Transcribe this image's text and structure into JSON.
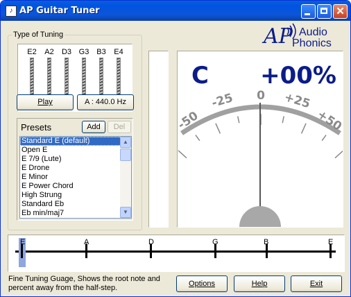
{
  "window": {
    "title": "AP Guitar Tuner",
    "minimize_icon": "minimize-icon",
    "maximize_icon": "maximize-icon",
    "close_icon": "close-icon"
  },
  "tuning": {
    "group_label": "Type of Tuning",
    "strings": [
      "E2",
      "A2",
      "D3",
      "G3",
      "B3",
      "E4"
    ],
    "play_label": "Play",
    "reference_label": "A : 440.0 Hz"
  },
  "presets": {
    "label": "Presets",
    "add_label": "Add",
    "del_label": "Del",
    "items": [
      "Standard E (default)",
      "Open E",
      "E 7/9 (Lute)",
      "E Drone",
      "E Minor",
      "E Power Chord",
      "High Strung",
      "Standard Eb",
      "Eb min/maj7"
    ],
    "selected_index": 0
  },
  "logo": {
    "line1": "Audio",
    "line2": "Phonics",
    "mark": "AP"
  },
  "gauge": {
    "note": "C",
    "cents": "+00%",
    "scale_labels": [
      "-50",
      "-25",
      "0",
      "+25",
      "+50"
    ]
  },
  "fine": {
    "notes": [
      "E",
      "A",
      "D",
      "G",
      "B",
      "E"
    ],
    "marker_note": "E"
  },
  "status_text": "Fine Tuning Guage, Shows the root note and percent away from the half-step.",
  "buttons": {
    "options": "Options",
    "help": "Help",
    "exit": "Exit"
  },
  "colors": {
    "titlebar": "#0054e3",
    "selection": "#316ac5",
    "gauge_text": "#0b1c8a",
    "marker": "#8fa6e0"
  }
}
